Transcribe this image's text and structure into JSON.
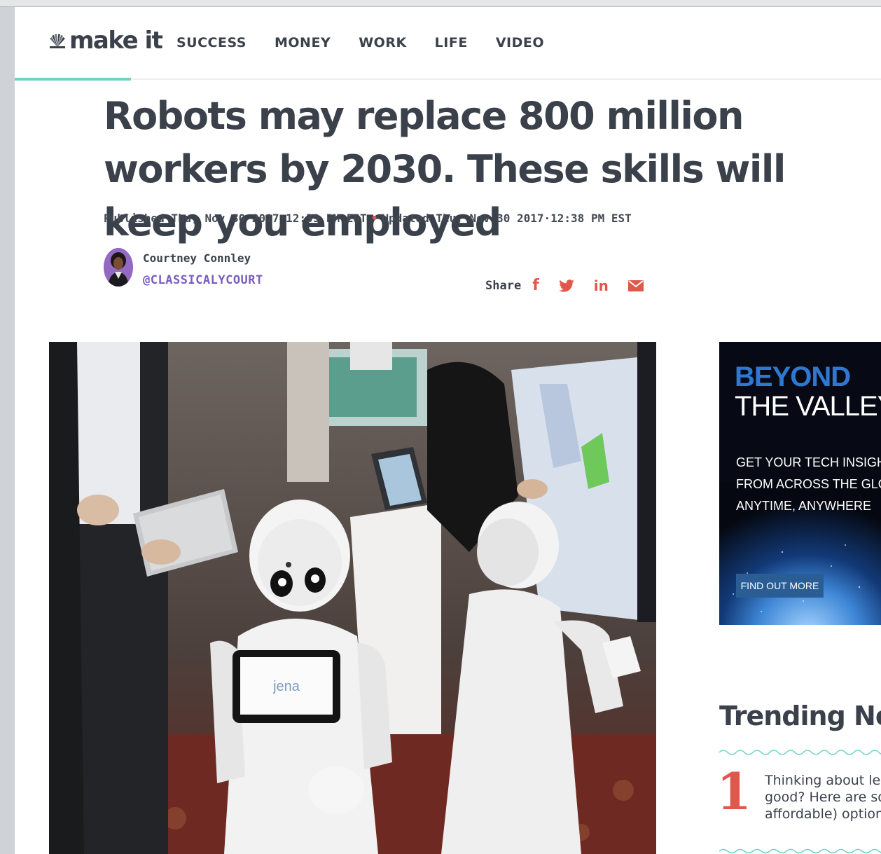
{
  "nav": {
    "logo_text": "make it",
    "items": [
      "SUCCESS",
      "MONEY",
      "WORK",
      "LIFE",
      "VIDEO"
    ]
  },
  "article": {
    "headline": "Robots may replace 800 million workers by 2030. These skills will keep you employed",
    "published": "Published Thu, Nov 30 2017·12:39 PM EST",
    "updated": "Updated Thu, Nov 30 2017·12:38 PM EST",
    "author": {
      "name": "Courtney Connley",
      "handle": "@CLASSICALYCOURT"
    },
    "share_label": "Share",
    "share_icons": [
      "facebook-icon",
      "twitter-icon",
      "linkedin-icon",
      "email-icon"
    ],
    "hero_tablet_text": "jena"
  },
  "ad": {
    "title_line1": "BEYOND",
    "title_line2": "THE VALLEY",
    "body_lines": [
      "GET YOUR TECH INSIGHT",
      "FROM ACROSS THE GLO",
      "ANYTIME, ANYWHERE"
    ],
    "cta": "FIND OUT MORE"
  },
  "trending": {
    "title": "Trending Now",
    "items": [
      {
        "rank": "1",
        "lines": [
          "Thinking about le",
          "good? Here are so",
          "affordable) option"
        ]
      }
    ]
  },
  "colors": {
    "text_dark": "#3b414b",
    "accent_red": "#e0574b",
    "accent_purple": "#7b5cc0",
    "accent_teal": "#70d1c8",
    "ad_blue": "#2f78d2"
  }
}
